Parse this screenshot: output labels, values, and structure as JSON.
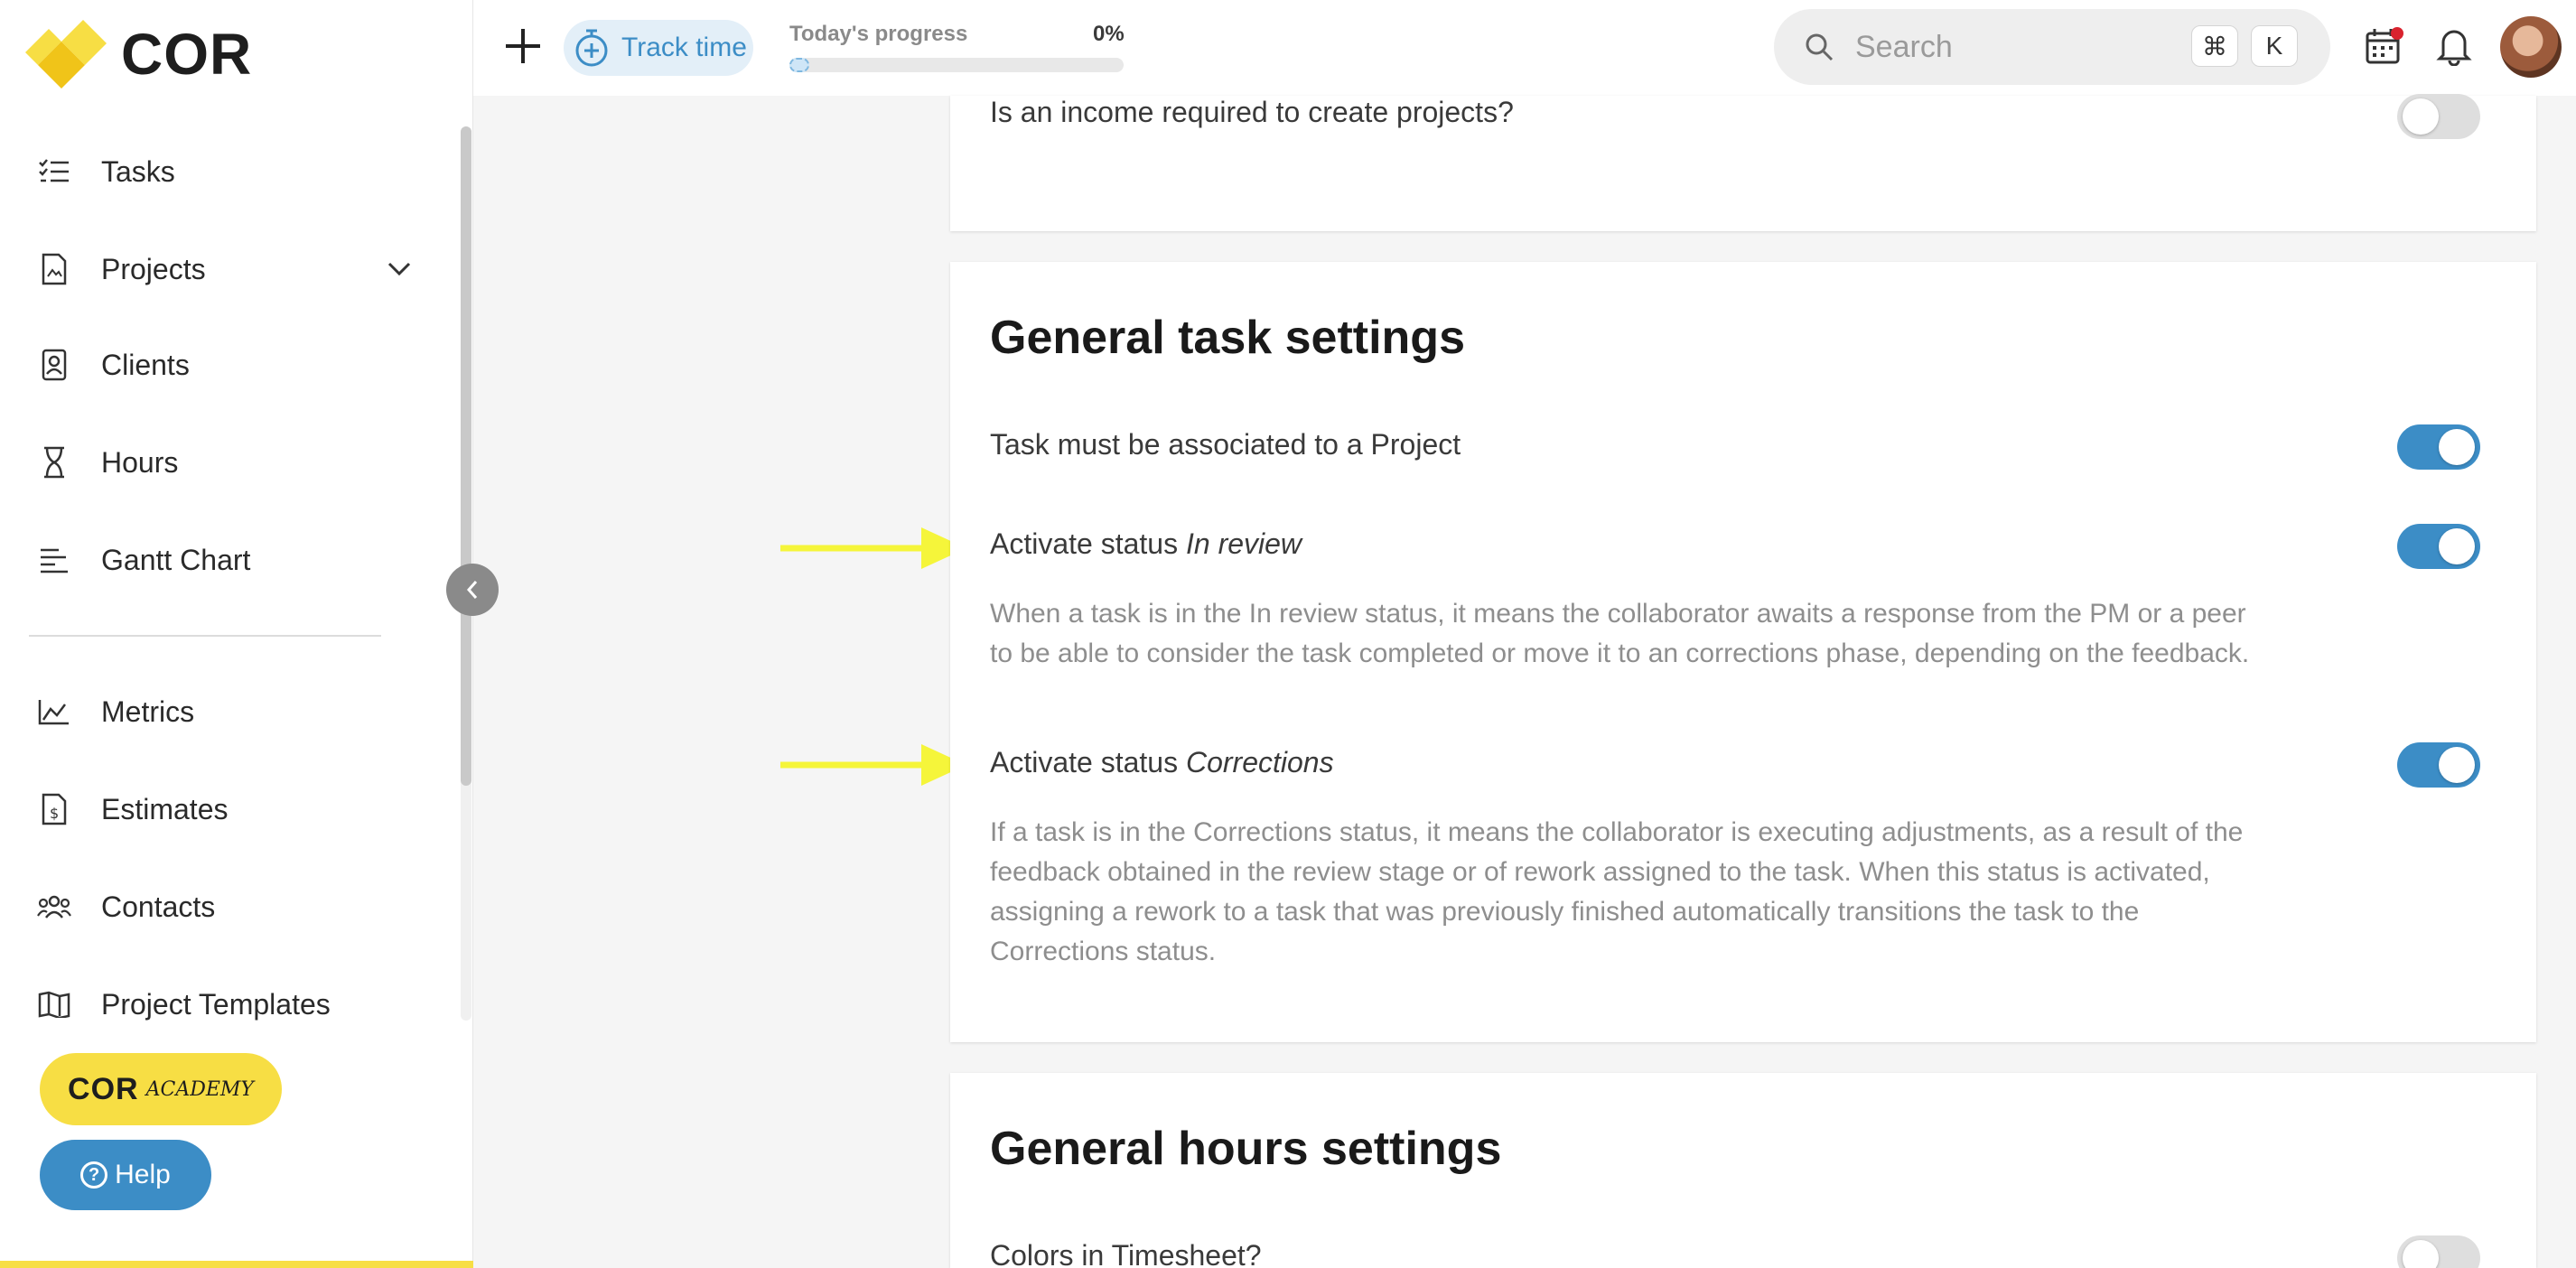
{
  "brand": {
    "name": "COR"
  },
  "sidebar": {
    "items": [
      {
        "label": "Tasks",
        "icon": "tasks-list-icon"
      },
      {
        "label": "Projects",
        "icon": "projects-icon",
        "has_submenu": true
      },
      {
        "label": "Clients",
        "icon": "clients-icon"
      },
      {
        "label": "Hours",
        "icon": "hourglass-icon"
      },
      {
        "label": "Gantt Chart",
        "icon": "gantt-icon"
      },
      {
        "label": "Metrics",
        "icon": "metrics-icon"
      },
      {
        "label": "Estimates",
        "icon": "estimates-icon"
      },
      {
        "label": "Contacts",
        "icon": "contacts-icon"
      },
      {
        "label": "Project Templates",
        "icon": "templates-icon"
      }
    ],
    "academy": {
      "brand": "COR",
      "sub": "ACADEMY"
    },
    "help_label": "Help"
  },
  "topbar": {
    "track_time_label": "Track time",
    "progress_label": "Today's progress",
    "progress_value": "0%",
    "progress_fraction": 0.03,
    "search_placeholder": "Search",
    "shortcut_keys": [
      "⌘",
      "K"
    ]
  },
  "cards": {
    "income": {
      "label": "Is an income required to create projects?",
      "enabled": false
    },
    "tasks": {
      "title": "General task settings",
      "settings": [
        {
          "label": "Task must be associated to a Project",
          "enabled": true
        },
        {
          "label_prefix": "Activate status ",
          "label_status": "In review",
          "description": "When a task is in the In review status, it means the collaborator awaits a response from the PM or a peer to be able to consider the task completed or move it to an corrections phase, depending on the feedback.",
          "enabled": true
        },
        {
          "label_prefix": "Activate status ",
          "label_status": "Corrections",
          "description": "If a task is in the Corrections status, it means the collaborator is executing adjustments, as a result of the feedback obtained in the review stage or of rework assigned to the task. When this status is activated, assigning a rework to a task that was previously finished automatically transitions the task to the Corrections status.",
          "enabled": true
        }
      ]
    },
    "hours": {
      "title": "General hours settings",
      "settings": [
        {
          "label": "Colors in Timesheet?",
          "enabled": false
        }
      ]
    }
  },
  "colors": {
    "accent_blue": "#3c8dc6",
    "brand_yellow": "#f7de44",
    "annotation_arrow": "#f5f53a"
  }
}
